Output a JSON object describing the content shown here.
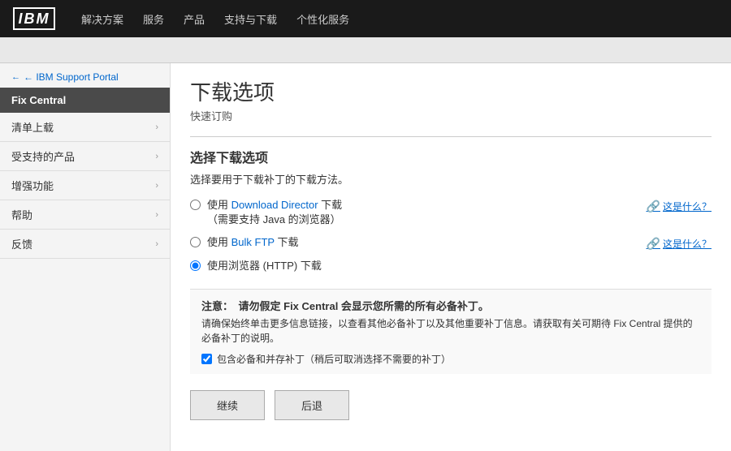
{
  "nav": {
    "logo": "IBM",
    "items": [
      "解决方案",
      "服务",
      "产品",
      "支持与下载",
      "个性化服务"
    ]
  },
  "sidebar": {
    "back_link": "← IBM Support Portal",
    "fix_central_label": "Fix Central",
    "items": [
      {
        "label": "清单上载"
      },
      {
        "label": "受支持的产品"
      },
      {
        "label": "增强功能"
      },
      {
        "label": "帮助"
      },
      {
        "label": "反馈"
      }
    ]
  },
  "content": {
    "page_title": "下载选项",
    "page_subtitle": "快速订购",
    "section_title": "选择下载选项",
    "section_desc": "选择要用于下载补丁的下载方法。",
    "radio_options": [
      {
        "id": "opt1",
        "label_part1": "使用 ",
        "label_highlight": "Download Director",
        "label_part2": " 下载",
        "label_sub": "（需要支持 Java 的浏览器）",
        "what_is_this": "这是什么？",
        "checked": false
      },
      {
        "id": "opt2",
        "label_part1": "使用 ",
        "label_highlight": "Bulk FTP",
        "label_part2": " 下载",
        "label_sub": "",
        "what_is_this": "这是什么？",
        "checked": false
      },
      {
        "id": "opt3",
        "label_part1": "使用浏览器 (HTTP) 下载",
        "label_highlight": "",
        "label_part2": "",
        "label_sub": "",
        "what_is_this": "",
        "checked": true
      }
    ],
    "notice": {
      "prefix": "注意：",
      "title_text": "请勿假定 Fix Central 会显示您所需的所有必备补丁。",
      "body": "请确保始终单击更多信息链接，以查看其他必备补丁以及其他重要补丁信息。请获取有关可期待 Fix Central 提供的必备补丁的说明。"
    },
    "checkbox_label": "包含必备和并存补丁（稍后可取消选择不需要的补丁）",
    "checkbox_checked": true,
    "btn_continue": "继续",
    "btn_back": "后退"
  }
}
